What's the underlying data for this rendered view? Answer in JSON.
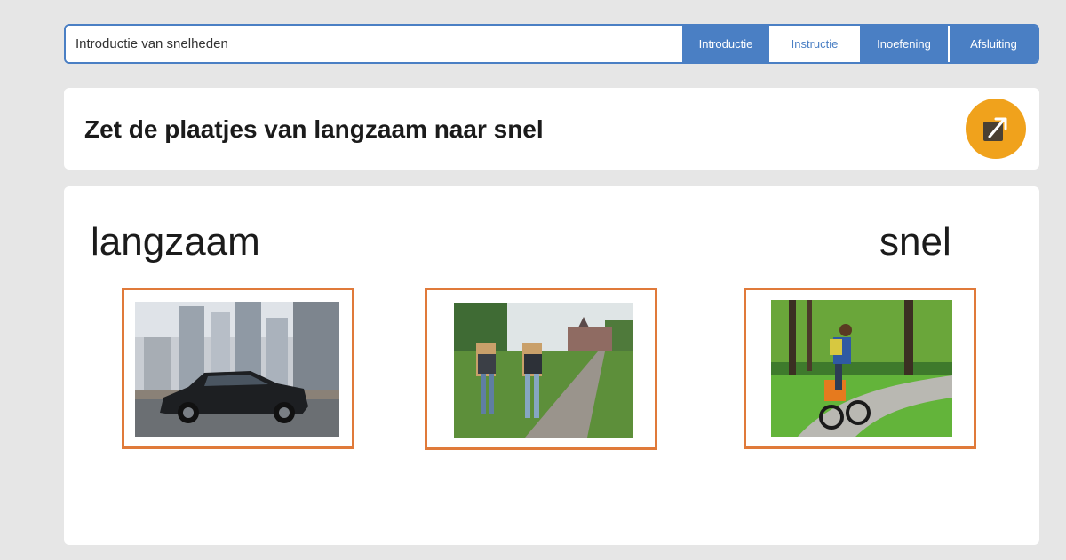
{
  "header": {
    "lesson_title": "Introductie van snelheden",
    "tabs": [
      {
        "label": "Introductie",
        "active": false
      },
      {
        "label": "Instructie",
        "active": true
      },
      {
        "label": "Inoefening",
        "active": false
      },
      {
        "label": "Afsluiting",
        "active": false
      }
    ]
  },
  "instruction": {
    "text": "Zet de plaatjes van langzaam naar snel",
    "open_icon": "external-link-icon"
  },
  "workspace": {
    "label_slow": "langzaam",
    "label_fast": "snel",
    "cards": [
      {
        "subject": "car-driving-city"
      },
      {
        "subject": "people-walking-path"
      },
      {
        "subject": "person-cycling-park"
      }
    ]
  },
  "colors": {
    "accent_blue": "#4a7fc4",
    "card_border": "#e07a3a",
    "open_button": "#f0a21c",
    "background": "#e6e6e6"
  }
}
